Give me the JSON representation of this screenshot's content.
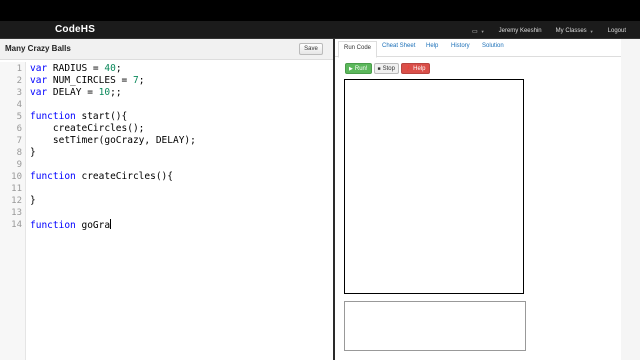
{
  "header": {
    "logo": "CodeHS",
    "user": "Jeremy Keeshin",
    "classes": "My Classes",
    "logout": "Logout"
  },
  "program": {
    "title": "Many Crazy Balls",
    "save_label": "Save"
  },
  "code_lines": [
    {
      "n": "1",
      "parts": [
        {
          "t": "var",
          "c": "kw"
        },
        {
          "t": " RADIUS = "
        },
        {
          "t": "40",
          "c": "num"
        },
        {
          "t": ";"
        }
      ]
    },
    {
      "n": "2",
      "parts": [
        {
          "t": "var",
          "c": "kw"
        },
        {
          "t": " NUM_CIRCLES = "
        },
        {
          "t": "7",
          "c": "num"
        },
        {
          "t": ";"
        }
      ]
    },
    {
      "n": "3",
      "parts": [
        {
          "t": "var",
          "c": "kw"
        },
        {
          "t": " DELAY = "
        },
        {
          "t": "10",
          "c": "num"
        },
        {
          "t": ";;"
        }
      ]
    },
    {
      "n": "4",
      "parts": []
    },
    {
      "n": "5",
      "parts": [
        {
          "t": "function",
          "c": "kw"
        },
        {
          "t": " start(){"
        }
      ]
    },
    {
      "n": "6",
      "parts": [
        {
          "t": "    createCircles();"
        }
      ]
    },
    {
      "n": "7",
      "parts": [
        {
          "t": "    setTimer(goCrazy, DELAY);"
        }
      ]
    },
    {
      "n": "8",
      "parts": [
        {
          "t": "}"
        }
      ]
    },
    {
      "n": "9",
      "parts": []
    },
    {
      "n": "10",
      "parts": [
        {
          "t": "function",
          "c": "kw"
        },
        {
          "t": " createCircles(){"
        }
      ]
    },
    {
      "n": "11",
      "parts": []
    },
    {
      "n": "12",
      "parts": [
        {
          "t": "}"
        }
      ]
    },
    {
      "n": "13",
      "parts": []
    },
    {
      "n": "14",
      "parts": [
        {
          "t": "function",
          "c": "kw"
        },
        {
          "t": " goGra"
        }
      ],
      "cursor": true
    }
  ],
  "tabs": [
    {
      "label": "Run Code",
      "active": true
    },
    {
      "label": "Cheat Sheet",
      "active": false
    },
    {
      "label": "Help",
      "active": false
    },
    {
      "label": "History",
      "active": false
    },
    {
      "label": "Solution",
      "active": false
    }
  ],
  "buttons": {
    "run": "Run!",
    "stop": "Stop",
    "help": "Help"
  },
  "icons": {
    "computer": "computer-icon",
    "play": "play-icon",
    "stop": "stop-icon",
    "help": "help-icon"
  },
  "colors": {
    "keyword": "#0000ff",
    "number": "#09885a",
    "run": "#5bb75b",
    "help": "#da4f49"
  }
}
